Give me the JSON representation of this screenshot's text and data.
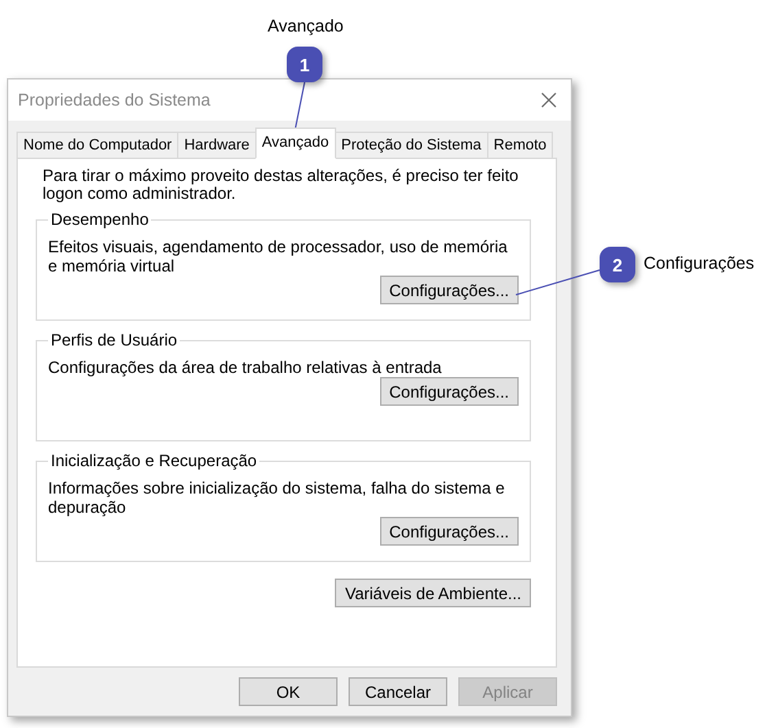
{
  "callouts": [
    {
      "number": "1",
      "label": "Avançado"
    },
    {
      "number": "2",
      "label": "Configurações"
    }
  ],
  "window": {
    "title": "Propriedades do Sistema"
  },
  "tabs": [
    {
      "label": "Nome do Computador",
      "selected": false
    },
    {
      "label": "Hardware",
      "selected": false
    },
    {
      "label": "Avançado",
      "selected": true
    },
    {
      "label": "Proteção do Sistema",
      "selected": false
    },
    {
      "label": "Remoto",
      "selected": false
    }
  ],
  "intro": "Para tirar o máximo proveito destas alterações, é preciso ter feito logon como administrador.",
  "groups": [
    {
      "title": "Desempenho",
      "description": "Efeitos visuais, agendamento de processador, uso de memória e memória virtual",
      "button": "Configurações..."
    },
    {
      "title": "Perfis de Usuário",
      "description": "Configurações da área de trabalho relativas à entrada",
      "button": "Configurações..."
    },
    {
      "title": "Inicialização e Recuperação",
      "description": "Informações sobre inicialização do sistema, falha do sistema e depuração",
      "button": "Configurações..."
    }
  ],
  "env_button": "Variáveis de Ambiente...",
  "buttons": [
    {
      "label": "OK",
      "disabled": false
    },
    {
      "label": "Cancelar",
      "disabled": false
    },
    {
      "label": "Aplicar",
      "disabled": true
    }
  ]
}
